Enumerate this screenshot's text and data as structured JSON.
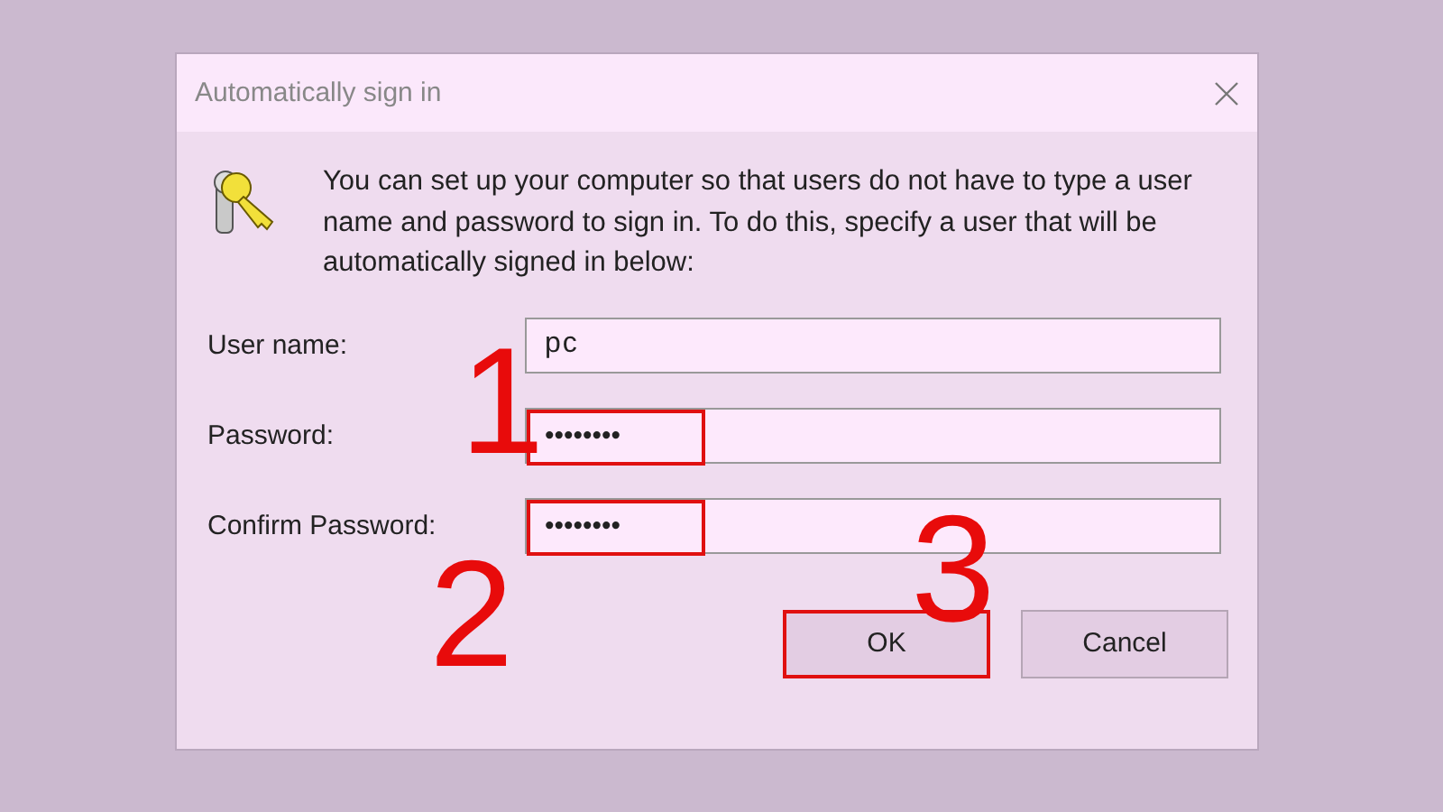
{
  "window": {
    "title": "Automatically sign in"
  },
  "description": "You can set up your computer so that users do not have to type a user name and password to sign in. To do this, specify a user that will be automatically signed in below:",
  "fields": [
    {
      "label": "User name:",
      "value": "pc",
      "kind": "text",
      "highlighted": false
    },
    {
      "label": "Password:",
      "value": "••••••••",
      "kind": "password",
      "highlighted": true
    },
    {
      "label": "Confirm Password:",
      "value": "••••••••",
      "kind": "password",
      "highlighted": true
    }
  ],
  "buttons": [
    {
      "label": "OK",
      "highlighted": true
    },
    {
      "label": "Cancel",
      "highlighted": false
    }
  ],
  "annotations": [
    {
      "number": "1"
    },
    {
      "number": "2"
    },
    {
      "number": "3"
    }
  ]
}
